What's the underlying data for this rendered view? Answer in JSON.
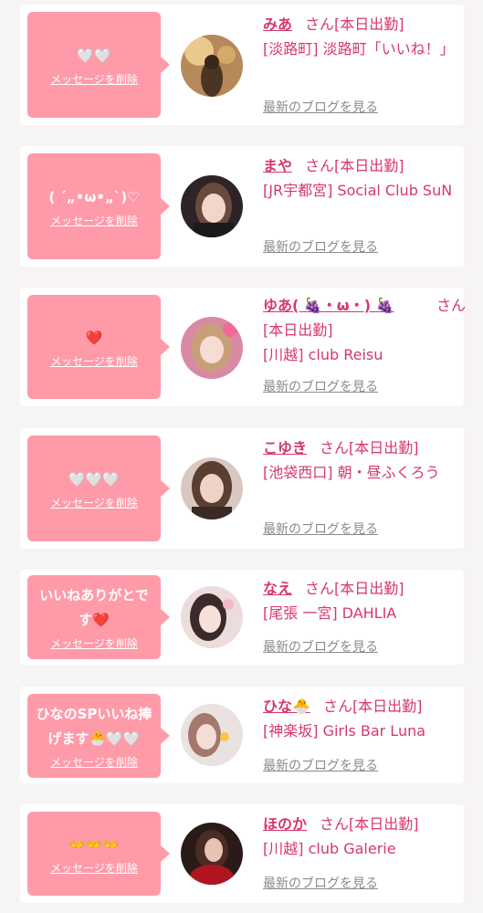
{
  "colors": {
    "bubble": "#ff9aa9",
    "accent": "#d8376a",
    "link_gray": "#8a8a8a",
    "background": "#f7f4f4",
    "card": "#ffffff"
  },
  "entries": [
    {
      "message": "🤍🤍",
      "delete_label": "メッセージを削除",
      "name": "みあ",
      "suffix": "さん[本日出勤]",
      "shop": "[淡路町] 淡路町「いいね！」",
      "blog_label": "最新のブログを見る"
    },
    {
      "message": "( ´„•ω•„`)♡",
      "delete_label": "メッセージを削除",
      "name": "まや",
      "suffix": "さん[本日出勤]",
      "shop": "[JR宇都宮] Social Club SuN",
      "blog_label": "最新のブログを見る"
    },
    {
      "message": "❤️",
      "delete_label": "メッセージを削除",
      "name": "ゆあ( 🍇・ω・) 🍇",
      "suffix": "さん",
      "status": "[本日出勤]",
      "shop": "[川越] club Reisu",
      "blog_label": "最新のブログを見る"
    },
    {
      "message": "🤍🤍🤍",
      "delete_label": "メッセージを削除",
      "name": "こゆき",
      "suffix": "さん[本日出勤]",
      "shop": "[池袋西口] 朝・昼ふくろう",
      "blog_label": "最新のブログを見る"
    },
    {
      "message": "いいねありがとです❤️",
      "delete_label": "メッセージを削除",
      "name": "なえ",
      "suffix": "さん[本日出勤]",
      "shop": "[尾張 一宮] DAHLIA",
      "blog_label": "最新のブログを見る"
    },
    {
      "message": "ひなのSPいいね捧げます🐣🤍🤍",
      "delete_label": "メッセージを削除",
      "name": "ひな🐣",
      "suffix": "さん[本日出勤]",
      "shop": "[神楽坂] Girls Bar Luna",
      "blog_label": "最新のブログを見る"
    },
    {
      "message": "👐👐👐",
      "delete_label": "メッセージを削除",
      "name": "ほのか",
      "suffix": "さん[本日出勤]",
      "shop": "[川越] club Galerie",
      "blog_label": "最新のブログを見る"
    }
  ]
}
